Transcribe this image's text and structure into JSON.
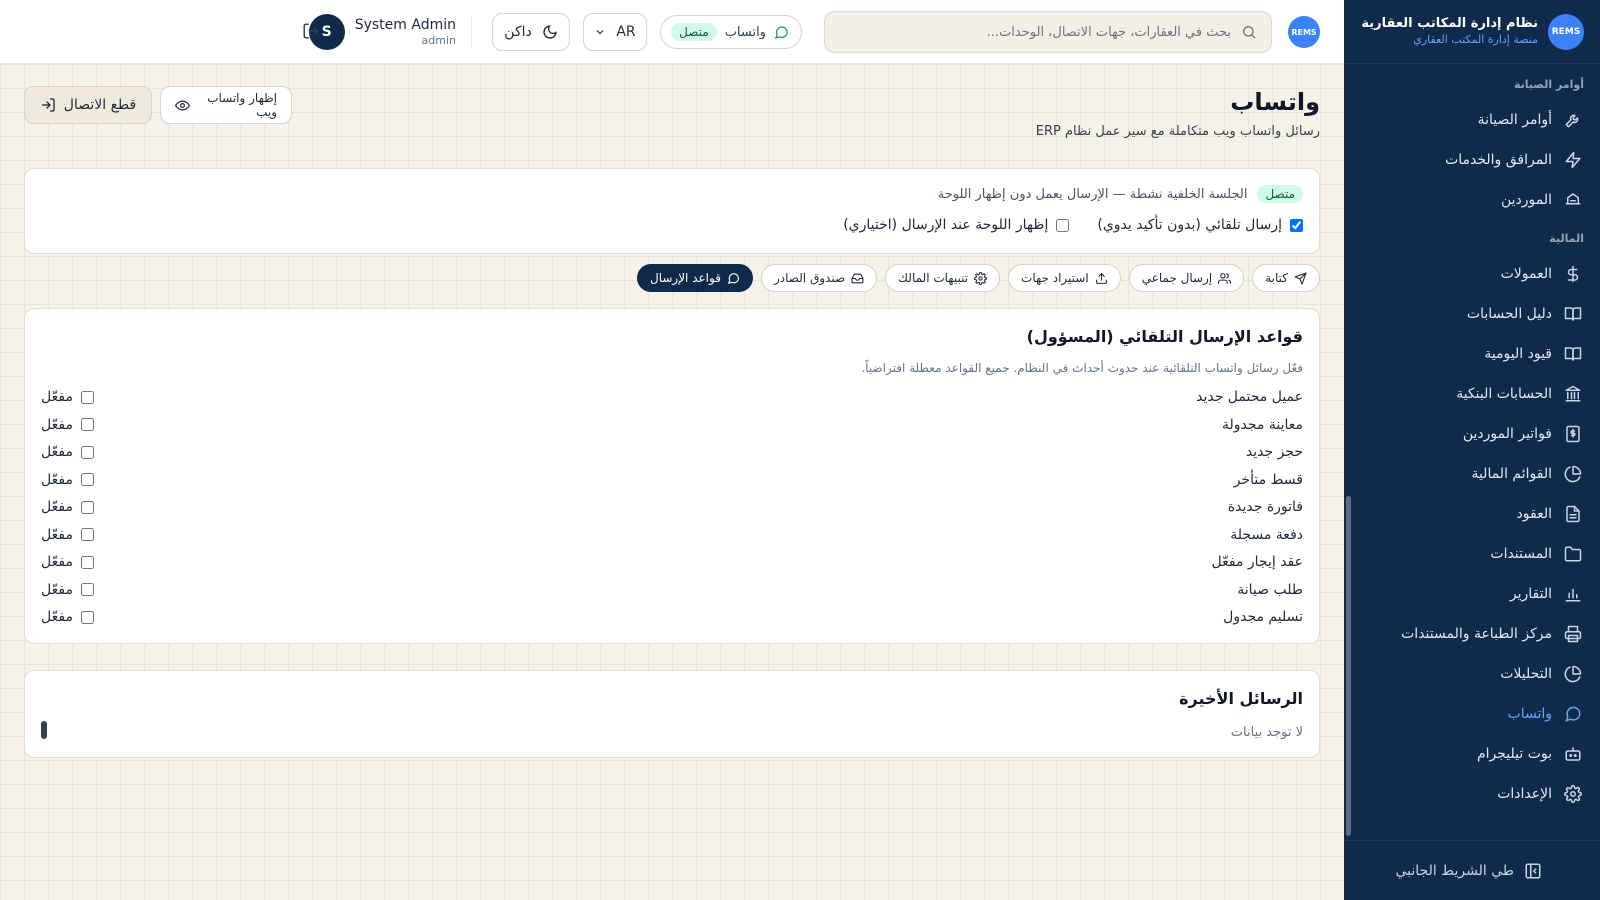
{
  "brand": {
    "logo_text": "REMS",
    "title": "نظام إدارة المكاتب العقارية",
    "subtitle": "منصة إدارة المكتب العقاري"
  },
  "sidebar": {
    "sections": [
      {
        "label": "أوامر الصيانة"
      },
      {
        "label": "المالية"
      }
    ],
    "group1": [
      {
        "label": "أوامر الصيانة",
        "icon": "wrench-icon"
      },
      {
        "label": "المرافق والخدمات",
        "icon": "bolt-icon"
      },
      {
        "label": "الموردين",
        "icon": "truck-icon"
      }
    ],
    "group2": [
      {
        "label": "العمولات",
        "icon": "dollar-icon"
      },
      {
        "label": "دليل الحسابات",
        "icon": "book-icon"
      },
      {
        "label": "قيود اليومية",
        "icon": "book-open-icon"
      },
      {
        "label": "الحسابات البنكية",
        "icon": "bank-icon"
      },
      {
        "label": "فواتير الموردين",
        "icon": "invoice-icon"
      },
      {
        "label": "القوائم المالية",
        "icon": "pie-icon"
      },
      {
        "label": "العقود",
        "icon": "file-icon"
      },
      {
        "label": "المستندات",
        "icon": "folder-icon"
      },
      {
        "label": "التقارير",
        "icon": "bar-chart-icon"
      },
      {
        "label": "مركز الطباعة والمستندات",
        "icon": "printer-icon"
      },
      {
        "label": "التحليلات",
        "icon": "pie-icon"
      },
      {
        "label": "واتساب",
        "icon": "chat-icon",
        "active": true
      },
      {
        "label": "بوت تيليجرام",
        "icon": "bot-icon"
      },
      {
        "label": "الإعدادات",
        "icon": "gear-icon"
      }
    ],
    "collapse_label": "طي الشريط الجانبي"
  },
  "topbar": {
    "avatar_text": "REMS",
    "search_placeholder": "بحث في العقارات، جهات الاتصال، الوحدات...",
    "whatsapp_label": "واتساب",
    "whatsapp_status": "متصل",
    "lang": "AR",
    "theme": "داكن",
    "user_name": "System Admin",
    "user_role": "admin",
    "user_initial": "S"
  },
  "page": {
    "title": "واتساب",
    "subtitle": "رسائل واتساب ويب متكاملة مع سير عمل نظام ERP",
    "show_web_label": "إظهار واتساب ويب",
    "disconnect_label": "قطع الاتصال"
  },
  "status": {
    "badge": "متصل",
    "message": "الجلسة الخلفية نشطة — الإرسال يعمل دون إظهار اللوحة",
    "auto_send_label": "إرسال تلقائي (بدون تأكيد يدوي)",
    "auto_send_checked": true,
    "show_panel_label": "إظهار اللوحة عند الإرسال (اختياري)",
    "show_panel_checked": false
  },
  "tabs": [
    {
      "label": "كتابة",
      "icon": "send-icon"
    },
    {
      "label": "إرسال جماعي",
      "icon": "users-icon"
    },
    {
      "label": "استيراد جهات",
      "icon": "upload-icon"
    },
    {
      "label": "تنبيهات المالك",
      "icon": "gear-icon"
    },
    {
      "label": "صندوق الصادر",
      "icon": "inbox-icon"
    },
    {
      "label": "قواعد الإرسال",
      "icon": "chat-icon",
      "active": true
    }
  ],
  "rules": {
    "title": "قواعد الإرسال التلقائي (المسؤول)",
    "description": "فعّل رسائل واتساب التلقائية عند حدوث أحداث في النظام. جميع القواعد معطلة افتراضياً.",
    "toggle_label": "مفعّل",
    "items": [
      {
        "label": "عميل محتمل جديد",
        "enabled": false
      },
      {
        "label": "معاينة مجدولة",
        "enabled": false
      },
      {
        "label": "حجز جديد",
        "enabled": false
      },
      {
        "label": "قسط متأخر",
        "enabled": false
      },
      {
        "label": "فاتورة جديدة",
        "enabled": false
      },
      {
        "label": "دفعة مسجلة",
        "enabled": false
      },
      {
        "label": "عقد إيجار مفعّل",
        "enabled": false
      },
      {
        "label": "طلب صيانة",
        "enabled": false
      },
      {
        "label": "تسليم مجدول",
        "enabled": false
      }
    ]
  },
  "recent": {
    "title": "الرسائل الأخيرة",
    "empty": "لا توجد بيانات"
  },
  "colors": {
    "sidebar_bg": "#0f2a4a",
    "accent": "#3b82f6",
    "success_bg": "#d1fae5",
    "success_text": "#065f46"
  }
}
